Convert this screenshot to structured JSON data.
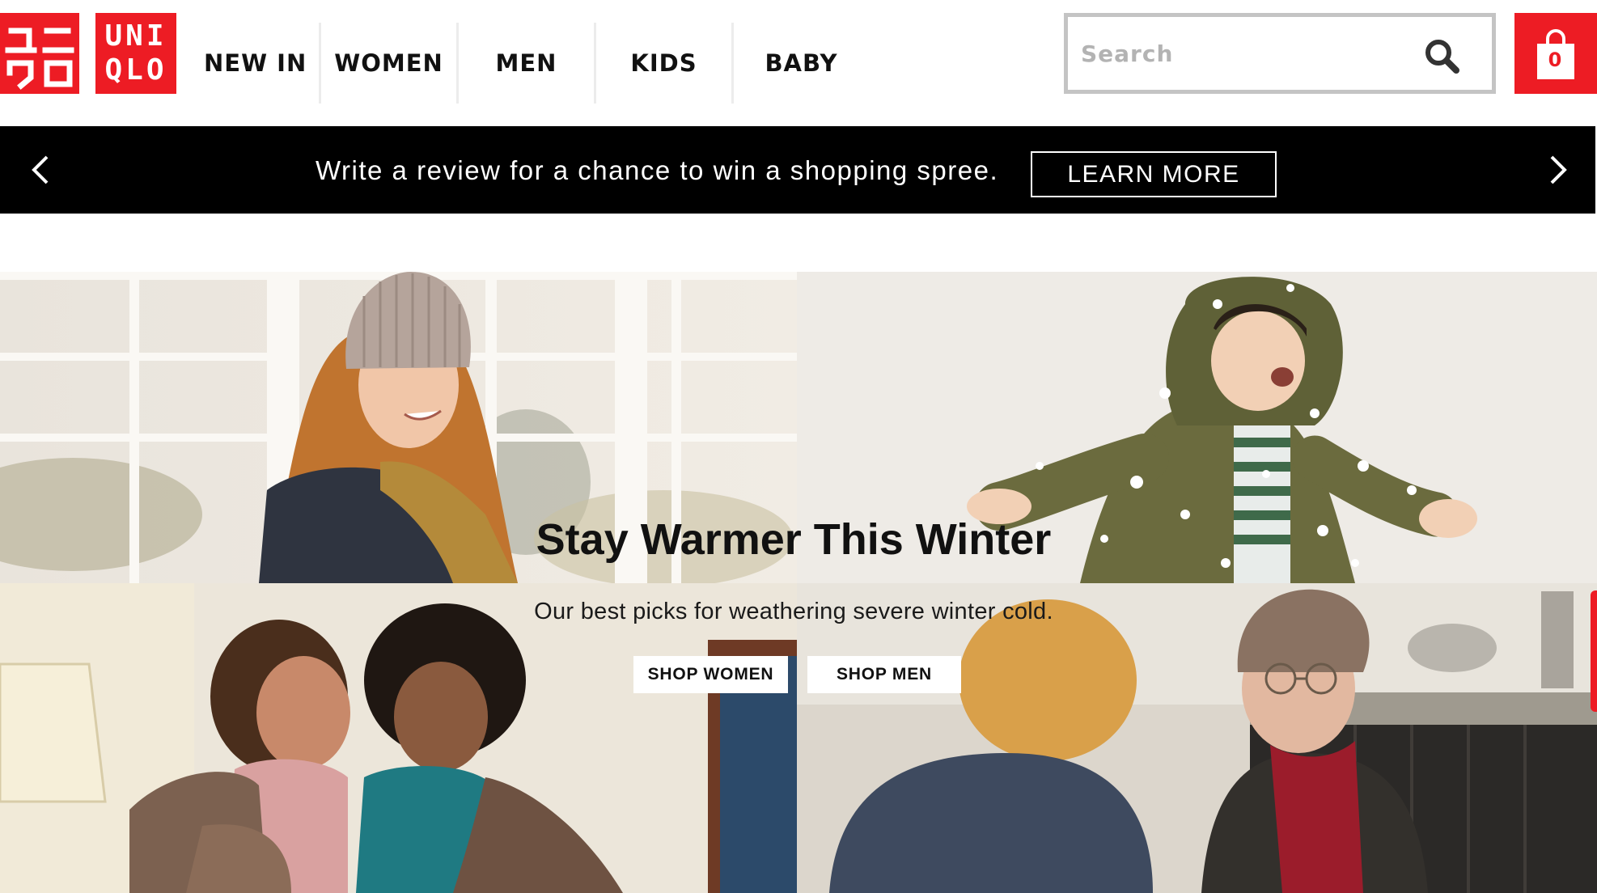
{
  "brand": {
    "logo_japanese": [
      "ユニ",
      "クロ"
    ],
    "logo_english": [
      "UNI",
      "QLO"
    ],
    "color": "#ed1c24"
  },
  "nav": {
    "items": [
      {
        "label": "NEW IN"
      },
      {
        "label": "WOMEN"
      },
      {
        "label": "MEN"
      },
      {
        "label": "KIDS"
      },
      {
        "label": "BABY"
      }
    ]
  },
  "search": {
    "placeholder": "Search",
    "value": "",
    "icon": "search-icon"
  },
  "cart": {
    "count": "0",
    "icon": "shopping-bag-icon"
  },
  "promo": {
    "text": "Write a review for a chance to win a shopping spree.",
    "button_label": "LEARN MORE",
    "prev_icon": "chevron-left-icon",
    "next_icon": "chevron-right-icon"
  },
  "hero": {
    "title": "Stay Warmer This Winter",
    "subtitle": "Our best picks for weathering severe winter cold.",
    "shop_women_label": "SHOP WOMEN",
    "shop_men_label": "SHOP MEN",
    "images": [
      "woman in knit beanie by window",
      "child in green puffer coat in snow",
      "two women wrapped in blanket",
      "man in beanie and red scarf at cafe"
    ]
  }
}
